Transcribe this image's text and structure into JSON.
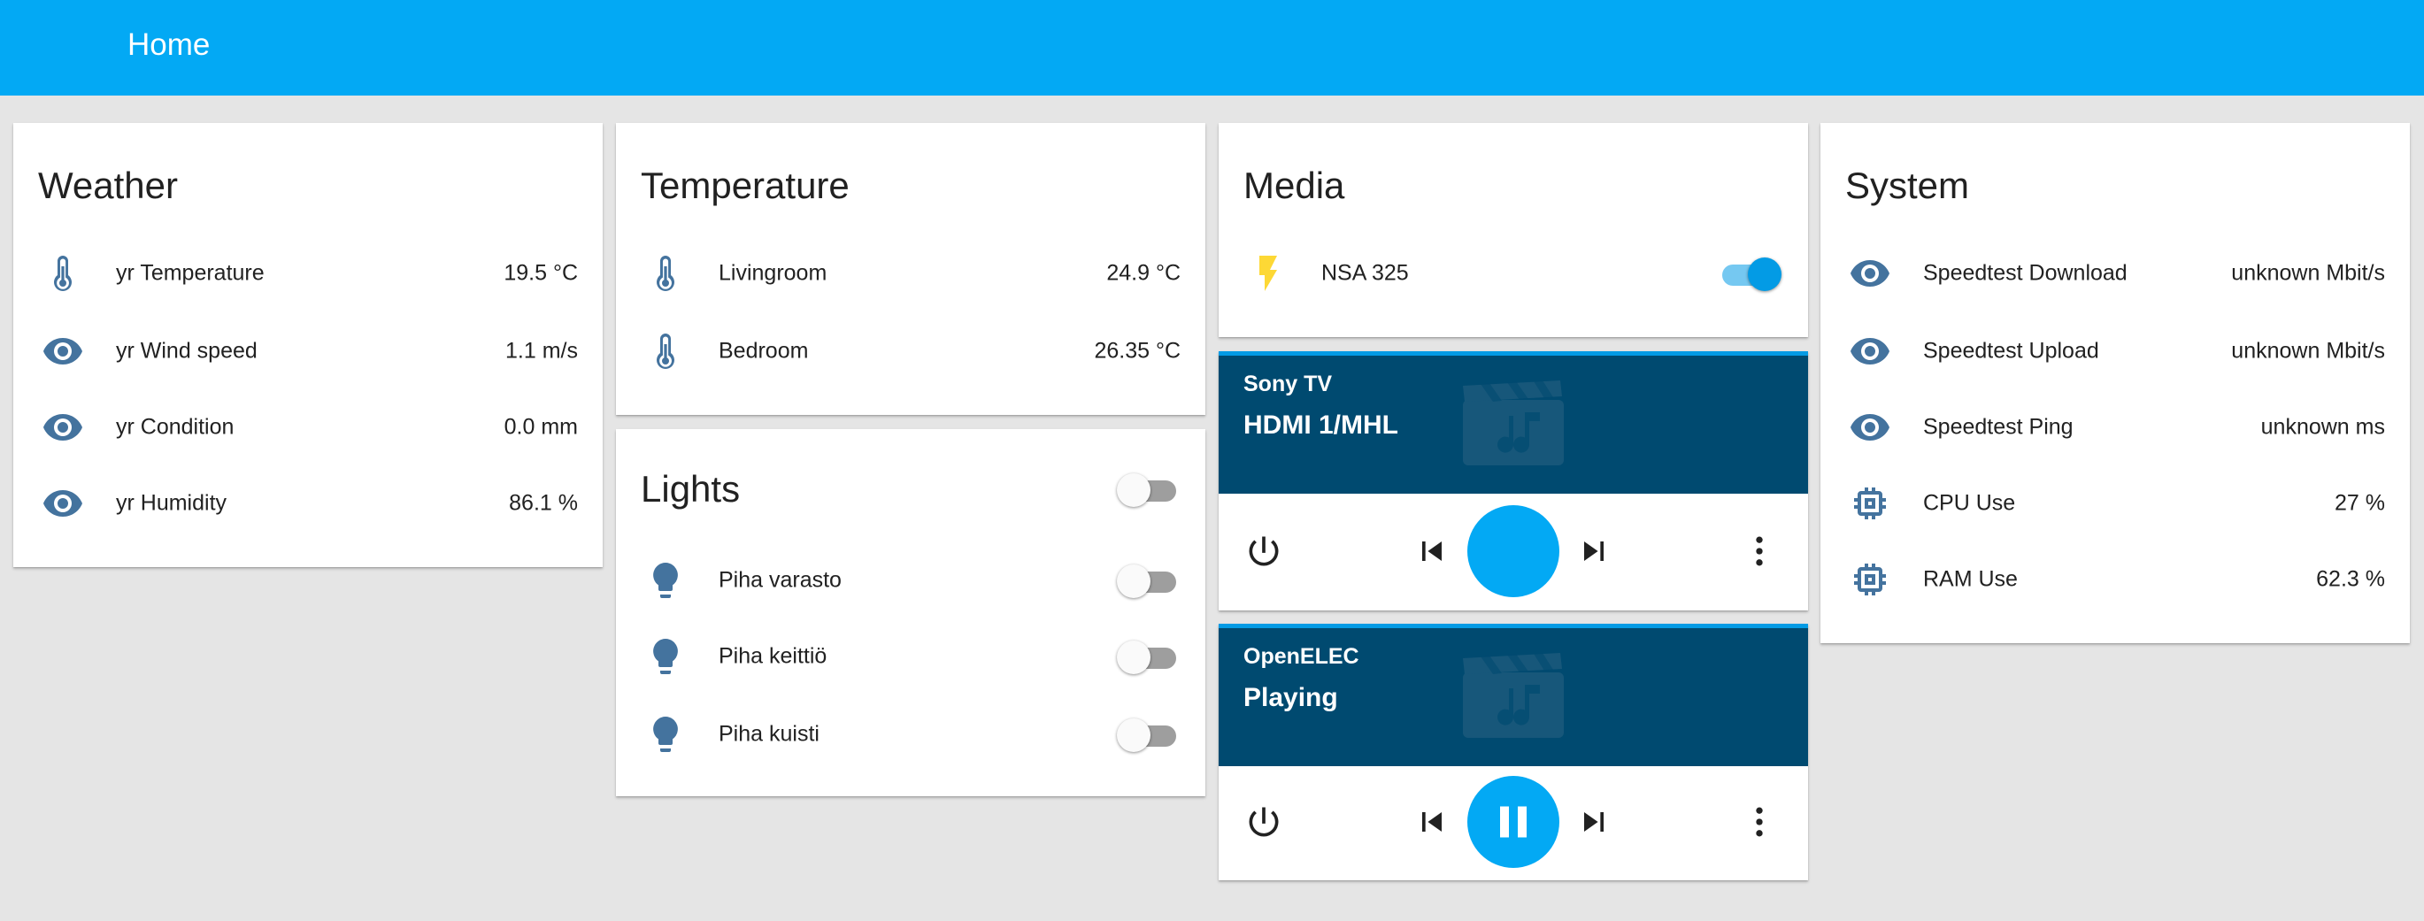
{
  "header": {
    "title": "Home"
  },
  "weather": {
    "title": "Weather",
    "rows": [
      {
        "icon": "thermometer-icon",
        "name": "yr Temperature",
        "value": "19.5 °C"
      },
      {
        "icon": "eye-icon",
        "name": "yr Wind speed",
        "value": "1.1 m/s"
      },
      {
        "icon": "eye-icon",
        "name": "yr Condition",
        "value": "0.0 mm"
      },
      {
        "icon": "eye-icon",
        "name": "yr Humidity",
        "value": "86.1 %"
      }
    ]
  },
  "temperature": {
    "title": "Temperature",
    "rows": [
      {
        "icon": "thermometer-icon",
        "name": "Livingroom",
        "value": "24.9 °C"
      },
      {
        "icon": "thermometer-icon",
        "name": "Bedroom",
        "value": "26.35 °C"
      }
    ]
  },
  "lights": {
    "title": "Lights",
    "group_on": false,
    "rows": [
      {
        "icon": "lightbulb-icon",
        "name": "Piha varasto",
        "on": false
      },
      {
        "icon": "lightbulb-icon",
        "name": "Piha keittiö",
        "on": false
      },
      {
        "icon": "lightbulb-icon",
        "name": "Piha kuisti",
        "on": false
      }
    ]
  },
  "media": {
    "title": "Media",
    "switch": {
      "icon": "flash-icon",
      "name": "NSA 325",
      "on": true
    },
    "players": [
      {
        "name": "Sony TV",
        "state": "HDMI 1/MHL",
        "playing": false
      },
      {
        "name": "OpenELEC",
        "state": "Playing",
        "playing": true
      }
    ]
  },
  "system": {
    "title": "System",
    "rows": [
      {
        "icon": "eye-icon",
        "name": "Speedtest Download",
        "value": "unknown Mbit/s"
      },
      {
        "icon": "eye-icon",
        "name": "Speedtest Upload",
        "value": "unknown Mbit/s"
      },
      {
        "icon": "eye-icon",
        "name": "Speedtest Ping",
        "value": "unknown ms"
      },
      {
        "icon": "chip-icon",
        "name": "CPU Use",
        "value": "27 %"
      },
      {
        "icon": "chip-icon",
        "name": "RAM Use",
        "value": "62.3 %"
      }
    ]
  },
  "colors": {
    "header": "#03a9f4",
    "accent": "#039be5",
    "icon": "#44739e",
    "flash": "#fdd835",
    "media_hero": "#004a70"
  }
}
